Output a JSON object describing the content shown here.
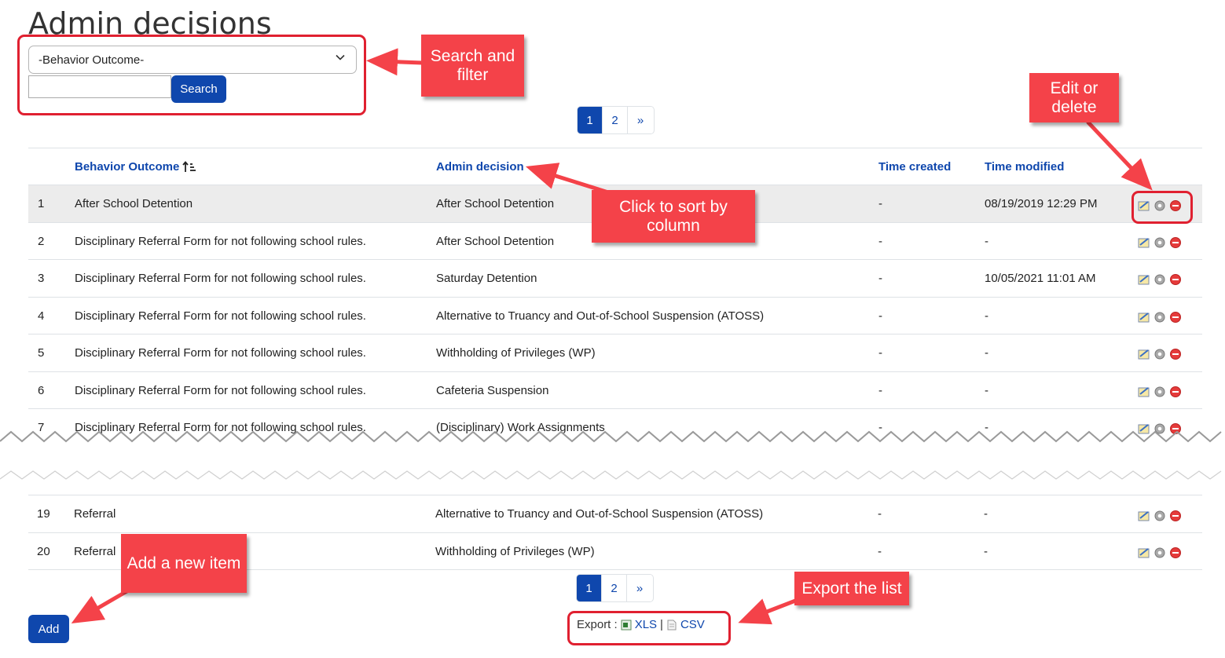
{
  "page": {
    "title": "Admin decisions"
  },
  "filter": {
    "selected": "-Behavior Outcome-",
    "search_placeholder": "",
    "search_button": "Search"
  },
  "pagination": {
    "pages": [
      "1",
      "2"
    ],
    "next": "»",
    "active": "1"
  },
  "table": {
    "headers": {
      "behavior_outcome": "Behavior Outcome",
      "admin_decision": "Admin decision",
      "time_created": "Time created",
      "time_modified": "Time modified"
    },
    "rows": [
      {
        "num": "1",
        "behavior": "After School Detention",
        "decision": "After School Detention",
        "created": "-",
        "modified": "08/19/2019 12:29 PM"
      },
      {
        "num": "2",
        "behavior": "Disciplinary Referral Form for not following school rules.",
        "decision": "After School Detention",
        "created": "-",
        "modified": "-"
      },
      {
        "num": "3",
        "behavior": "Disciplinary Referral Form for not following school rules.",
        "decision": "Saturday Detention",
        "created": "-",
        "modified": "10/05/2021 11:01 AM"
      },
      {
        "num": "4",
        "behavior": "Disciplinary Referral Form for not following school rules.",
        "decision": "Alternative to Truancy and Out-of-School Suspension (ATOSS)",
        "created": "-",
        "modified": "-"
      },
      {
        "num": "5",
        "behavior": "Disciplinary Referral Form for not following school rules.",
        "decision": "Withholding of Privileges (WP)",
        "created": "-",
        "modified": "-"
      },
      {
        "num": "6",
        "behavior": "Disciplinary Referral Form for not following school rules.",
        "decision": "Cafeteria Suspension",
        "created": "-",
        "modified": "-"
      },
      {
        "num": "7",
        "behavior": "Disciplinary Referral Form for not following school rules.",
        "decision": "(Disciplinary) Work Assignments",
        "created": "-",
        "modified": "-"
      },
      {
        "num": "19",
        "behavior": "Referral",
        "decision": "Alternative to Truancy and Out-of-School Suspension (ATOSS)",
        "created": "-",
        "modified": "-"
      },
      {
        "num": "20",
        "behavior": "Referral",
        "decision": "Withholding of Privileges (WP)",
        "created": "-",
        "modified": "-"
      }
    ]
  },
  "actions": {
    "add_button": "Add"
  },
  "export": {
    "label": "Export :",
    "xls": "XLS",
    "separator": "|",
    "csv": "CSV"
  },
  "callouts": {
    "search_filter": "Search and filter",
    "edit_delete": "Edit or delete",
    "sort": "Click to sort by column",
    "add": "Add a new item",
    "export": "Export the list"
  },
  "colors": {
    "accent": "#0f47ad",
    "callout": "#f44249",
    "highlight_row": "#ececec"
  }
}
